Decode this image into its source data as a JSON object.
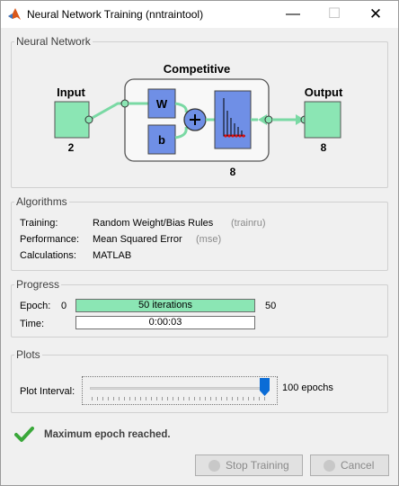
{
  "window": {
    "title": "Neural Network Training (nntraintool)",
    "controls": {
      "minimize": "—",
      "maximize": "☐",
      "close": "✕"
    }
  },
  "network": {
    "legend": "Neural Network",
    "input_label": "Input",
    "input_size": "2",
    "layer_label": "Competitive",
    "weight_label": "W",
    "bias_label": "b",
    "layer_size": "8",
    "output_label": "Output",
    "output_size": "8"
  },
  "algorithms": {
    "legend": "Algorithms",
    "rows": [
      {
        "label": "Training:",
        "value": "Random Weight/Bias Rules",
        "note": "(trainru)"
      },
      {
        "label": "Performance:",
        "value": "Mean Squared Error",
        "note": "(mse)"
      },
      {
        "label": "Calculations:",
        "value": "MATLAB",
        "note": ""
      }
    ]
  },
  "progress": {
    "legend": "Progress",
    "epoch_label": "Epoch:",
    "epoch_min": "0",
    "epoch_text": "50 iterations",
    "epoch_max": "50",
    "epoch_fraction": 1.0,
    "time_label": "Time:",
    "time_value": "0:00:03"
  },
  "plots": {
    "legend": "Plots",
    "interval_label": "Plot Interval:",
    "interval_value": "100 epochs",
    "slider_fraction": 1.0
  },
  "status": {
    "message": "Maximum epoch reached."
  },
  "buttons": {
    "stop": "Stop Training",
    "cancel": "Cancel"
  },
  "colors": {
    "accent_green": "#8be6b4",
    "block_blue": "#6f8fe6",
    "slider_blue": "#0a6cd6"
  }
}
